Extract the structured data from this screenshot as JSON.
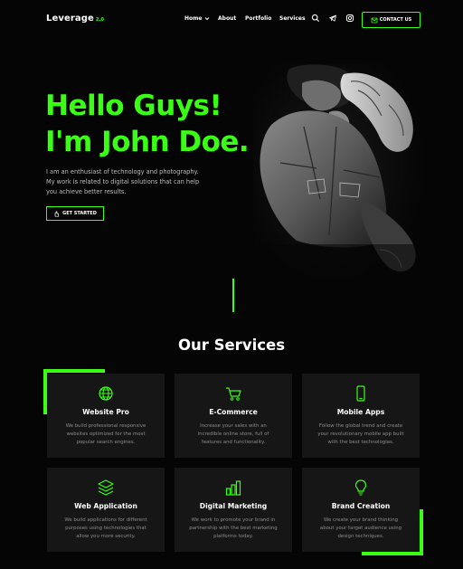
{
  "brand": {
    "name": "Leverage",
    "version": "2.0"
  },
  "nav": {
    "items": [
      "Home",
      "About",
      "Portfolio",
      "Services"
    ],
    "contact_label": "CONTACT US"
  },
  "hero": {
    "title_line1": "Hello Guys!",
    "title_line2": "I'm John Doe.",
    "description_lines": [
      "I am an enthusiast of technology and photography.",
      "My work is related to digital solutions that can help",
      "you achieve better results."
    ],
    "cta_label": "GET STARTED"
  },
  "services": {
    "title": "Our Services",
    "items": [
      {
        "icon": "globe-icon",
        "title": "Website Pro",
        "desc": [
          "We build professional responsive",
          "websites optimized for the most",
          "popular search engines."
        ]
      },
      {
        "icon": "cart-icon",
        "title": "E-Commerce",
        "desc": [
          "Increase your sales with an",
          "incredible online store, full of",
          "features and functionality."
        ]
      },
      {
        "icon": "mobile-icon",
        "title": "Mobile Apps",
        "desc": [
          "Follow the global trend and create",
          "your revolutionary mobile app built",
          "with the best technologies."
        ]
      },
      {
        "icon": "layers-icon",
        "title": "Web Application",
        "desc": [
          "We build applications for different",
          "purposes using technologies that",
          "allow you more security."
        ]
      },
      {
        "icon": "bar-chart-icon",
        "title": "Digital Marketing",
        "desc": [
          "We work to promote your brand in",
          "partnership with the best marketing",
          "platforms today."
        ]
      },
      {
        "icon": "lightbulb-icon",
        "title": "Brand Creation",
        "desc": [
          "We create your brand thinking",
          "about your target audience using",
          "design techniques."
        ]
      }
    ]
  },
  "colors": {
    "accent": "#39ff14",
    "background": "#050505",
    "card": "#161616"
  }
}
